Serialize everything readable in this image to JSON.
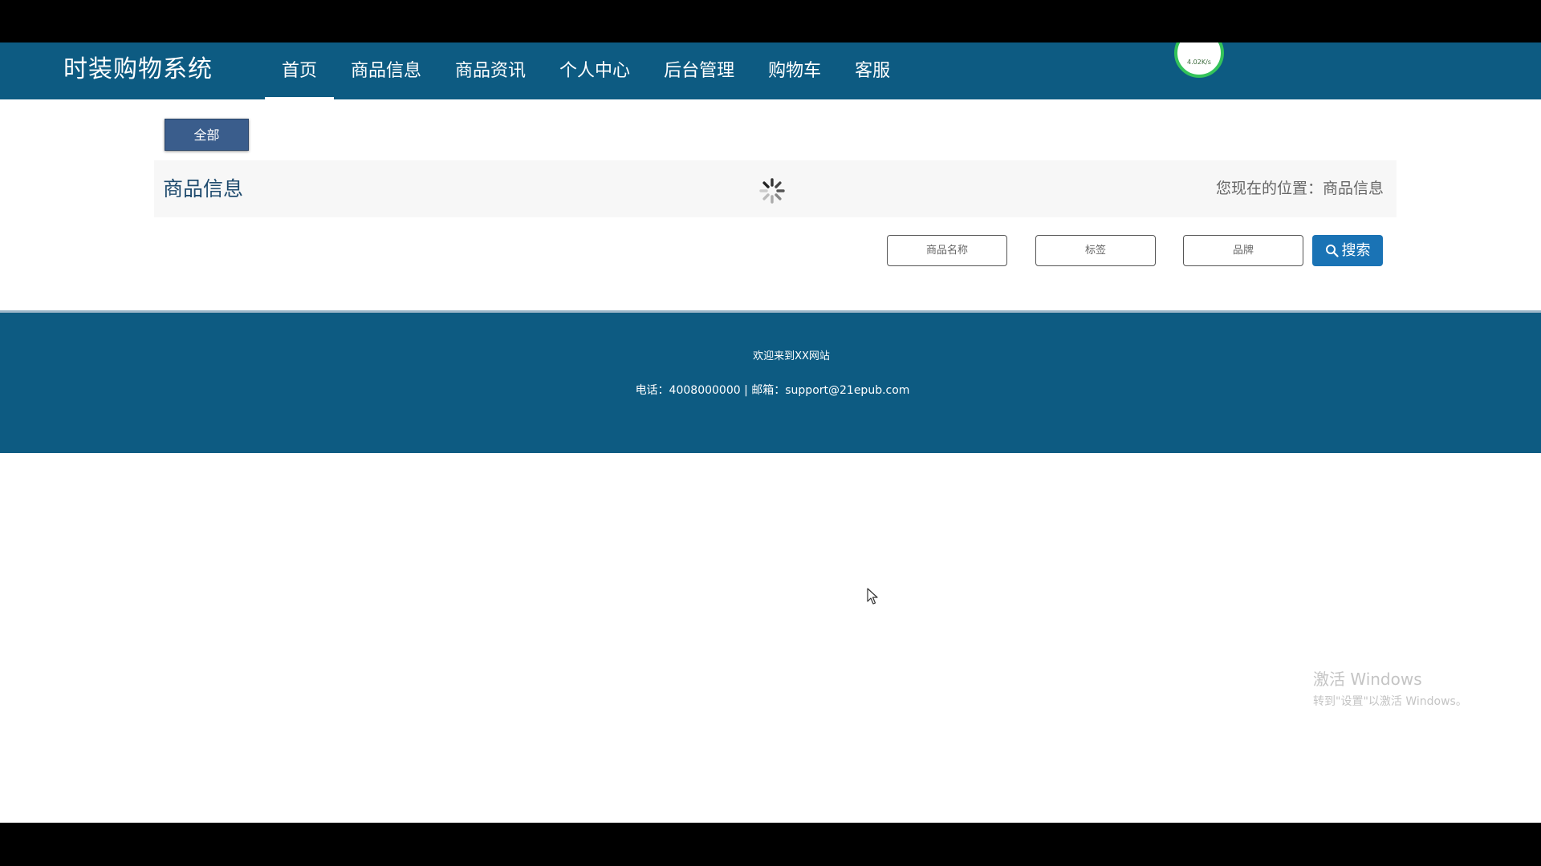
{
  "header": {
    "brand": "时装购物系统",
    "nav": [
      {
        "label": "首页",
        "active": true
      },
      {
        "label": "商品信息",
        "active": false
      },
      {
        "label": "商品资讯",
        "active": false
      },
      {
        "label": "个人中心",
        "active": false
      },
      {
        "label": "后台管理",
        "active": false
      },
      {
        "label": "购物车",
        "active": false
      },
      {
        "label": "客服",
        "active": false
      }
    ],
    "speed_badge": "4.02K/s"
  },
  "filter": {
    "all_label": "全部"
  },
  "section": {
    "title": "商品信息",
    "location": "您现在的位置：商品信息"
  },
  "search": {
    "name_placeholder": "商品名称",
    "tag_placeholder": "标签",
    "brand_placeholder": "品牌",
    "button_label": "搜索",
    "button_icon": "search-icon"
  },
  "footer": {
    "welcome": "欢迎来到XX网站",
    "contact": "电话：4008000000 | 邮箱：support@21epub.com"
  },
  "watermark": {
    "line1": "激活 Windows",
    "line2": "转到\"设置\"以激活 Windows。"
  },
  "colors": {
    "primary": "#0d5b82",
    "button_dark": "#3a5d8c",
    "search_button": "#1a73b5"
  }
}
